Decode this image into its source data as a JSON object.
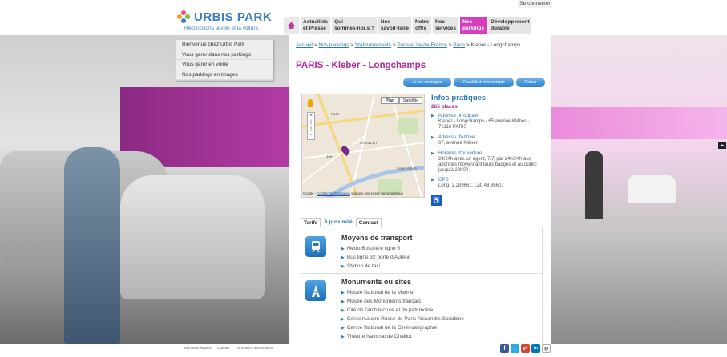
{
  "header": {
    "brand": "URBIS PARK",
    "tagline": "Réconcilions la ville et la voiture",
    "connect": "Se connecter"
  },
  "nav": {
    "items": [
      {
        "label": "Actualités\net Presse"
      },
      {
        "label": "Qui\nsommes-nous ?"
      },
      {
        "label": "Nos\nsavoir-faire"
      },
      {
        "label": "Notre\noffre"
      },
      {
        "label": "Nos\nservices"
      },
      {
        "label": "Nos\nparkings"
      },
      {
        "label": "Développement\ndurable"
      }
    ]
  },
  "submenu": [
    "Bienvenue chez Urbis Park",
    "Vous garer dans nos parkings",
    "Vous garer en voirie",
    "Nos parkings en images"
  ],
  "breadcrumb": {
    "items": [
      "Accueil",
      "Nos parkings",
      "Stationnements",
      "Paris et Ile-de-France",
      "Paris"
    ],
    "current": "Kleber - Longchamps"
  },
  "page_title": "PARIS - Kleber - Longchamps",
  "buttons": {
    "renseigne": "Je me renseigne",
    "compte": "J'accède à mon compte",
    "retour": "Retour"
  },
  "map": {
    "plan": "Plan",
    "satellite": "Satellite",
    "footer_logo": "Google",
    "footer_terms": "Conditions d'utilisation",
    "footer_report": "Signaler une erreur cartographique",
    "labels": [
      "Foch",
      "CHAILLOT",
      "Cours Albert",
      "16e"
    ]
  },
  "infos": {
    "title": "Infos pratiques",
    "places": "265 places",
    "address_h": "Adresse principale",
    "address_v": "Kleber - Longchamps - 65 avenue Kléber -\n75116 PARIS",
    "entree_h": "Adresse d'entrée",
    "entree_v": "67, avenue Kléber",
    "horaires_h": "Horaires d'ouverture",
    "horaires_v": "24/24h avec un agent, 7/7j par 24h/24h aux\nabonnés moyennant leurs badges et au public\njusqu'à 22h00",
    "gps_h": "GPS",
    "gps_v": "Long. 2.289661, Lat. 48.86607"
  },
  "tabs": [
    "Tarifs",
    "A proximité",
    "Contact"
  ],
  "transport": {
    "title": "Moyens de transport",
    "items": [
      "Métro Boissière ligne 6",
      "Bus ligne 32 porte d'Auteuil",
      "Station de taxi"
    ]
  },
  "monuments": {
    "title": "Monuments ou sites",
    "items": [
      "Musée National de la Marine",
      "Musée des Monuments français",
      "Cité de l'architecture et du patrimoine",
      "Conservatoire Russe de Paris Alexandre Scriabine",
      "Centre National de la Cinématographie",
      "Théâtre National de Chaillot"
    ]
  },
  "footer": {
    "links": [
      "Mentions légales",
      "Contact",
      "Formulaire d'inscription"
    ]
  },
  "social": [
    {
      "icon": "facebook-icon",
      "glyph": "f",
      "color": "#3b5998"
    },
    {
      "icon": "twitter-icon",
      "glyph": "t",
      "color": "#29a9e1"
    },
    {
      "icon": "googleplus-icon",
      "glyph": "g+",
      "color": "#d34836"
    },
    {
      "icon": "linkedin-icon",
      "glyph": "in",
      "color": "#0077b5"
    },
    {
      "icon": "share-icon",
      "glyph": "↻",
      "color": "#888888"
    }
  ],
  "colors": {
    "accent": "#b02a9c",
    "link": "#2a7ab8",
    "active_nav": "#d53fbd"
  }
}
